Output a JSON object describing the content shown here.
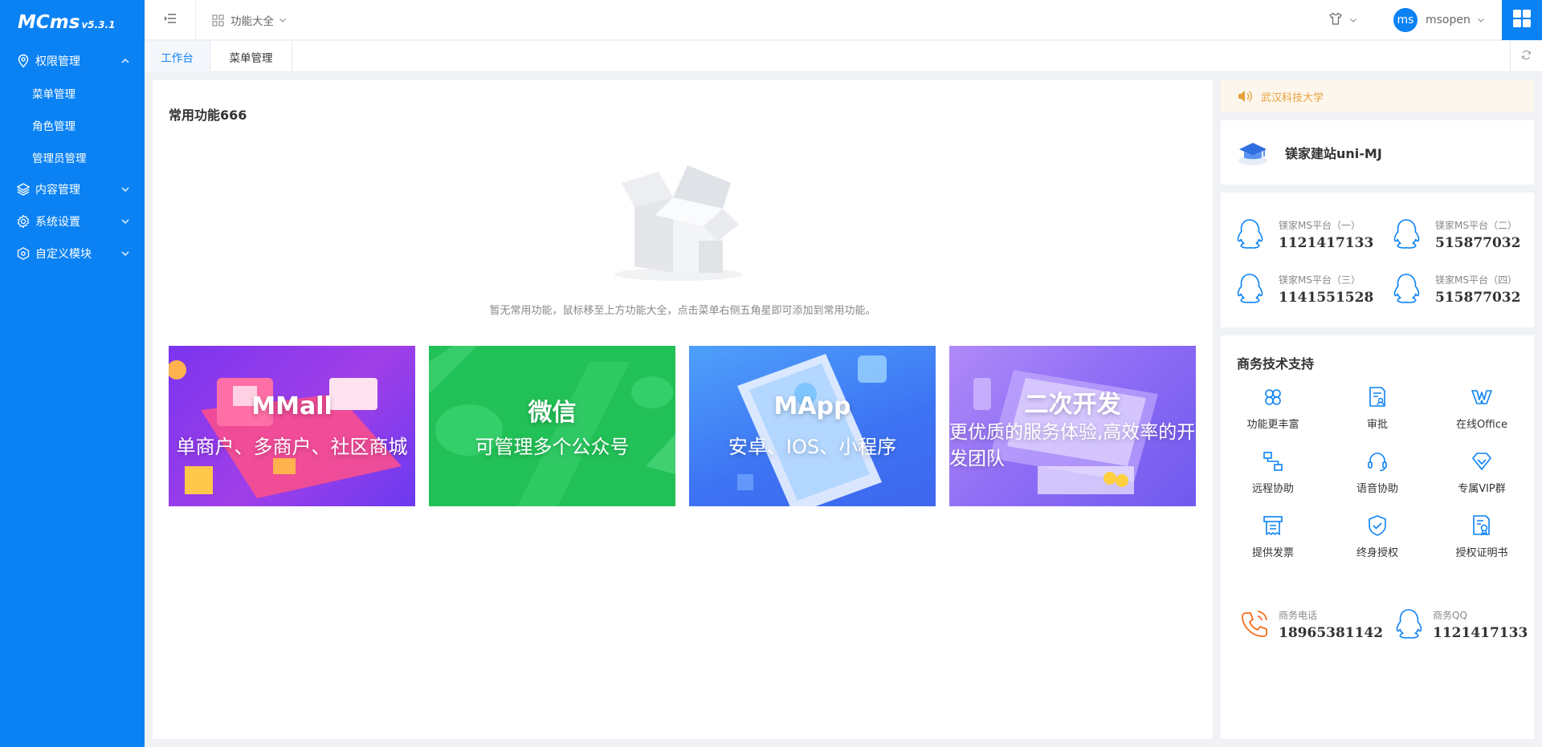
{
  "app": {
    "brand": "MCms",
    "version": "v5.3.1"
  },
  "sidebar": {
    "groups": [
      {
        "label": "权限管理",
        "expanded": true,
        "icon": "map-pin-icon",
        "items": [
          {
            "label": "菜单管理"
          },
          {
            "label": "角色管理"
          },
          {
            "label": "管理员管理"
          }
        ]
      },
      {
        "label": "内容管理",
        "expanded": false,
        "icon": "layers-icon"
      },
      {
        "label": "系统设置",
        "expanded": false,
        "icon": "gear-icon"
      },
      {
        "label": "自定义模块",
        "expanded": false,
        "icon": "module-icon"
      }
    ]
  },
  "header": {
    "func_all_label": "功能大全",
    "user": {
      "avatar_text": "ms",
      "name": "msopen"
    }
  },
  "tabs": [
    {
      "label": "工作台",
      "active": true
    },
    {
      "label": "菜单管理",
      "active": false
    }
  ],
  "main": {
    "title": "常用功能666",
    "empty_text": "暂无常用功能，鼠标移至上方功能大全，点击菜单右侧五角星即可添加到常用功能。",
    "banners": [
      {
        "title": "MMall",
        "subtitle": "单商户、多商户、社区商城",
        "color": "#8a3ff0"
      },
      {
        "title": "微信",
        "subtitle": "可管理多个公众号",
        "color": "#22c157"
      },
      {
        "title": "MApp",
        "subtitle": "安卓、IOS、小程序",
        "color": "#3f7ff5"
      },
      {
        "title": "二次开发",
        "subtitle": "更优质的服务体验,高效率的开发团队",
        "color": "#9b6cf6"
      }
    ]
  },
  "right": {
    "notice": "武汉科技大学",
    "product": {
      "name": "镁家建站uni-MJ"
    },
    "qq_groups": [
      {
        "label": "镁家MS平台（一）",
        "number": "1121417133"
      },
      {
        "label": "镁家MS平台（二）",
        "number": "515877032"
      },
      {
        "label": "镁家MS平台（三）",
        "number": "1141551528"
      },
      {
        "label": "镁家MS平台（四）",
        "number": "515877032"
      }
    ],
    "support": {
      "title": "商务技术支持",
      "items": [
        {
          "label": "功能更丰富",
          "icon": "clover-icon"
        },
        {
          "label": "审批",
          "icon": "approval-doc-icon"
        },
        {
          "label": "在线Office",
          "icon": "wps-office-icon"
        },
        {
          "label": "远程协助",
          "icon": "remote-flow-icon"
        },
        {
          "label": "语音协助",
          "icon": "headset-icon"
        },
        {
          "label": "专属VIP群",
          "icon": "diamond-icon"
        },
        {
          "label": "提供发票",
          "icon": "invoice-icon"
        },
        {
          "label": "终身授权",
          "icon": "shield-check-icon"
        },
        {
          "label": "授权证明书",
          "icon": "certificate-icon"
        }
      ],
      "phone": {
        "label": "商务电话",
        "number": "18965381142"
      },
      "qq": {
        "label": "商务QQ",
        "number": "1121417133"
      }
    }
  },
  "colors": {
    "primary": "#0b82f4",
    "notice_text": "#e6a23c",
    "notice_bg": "#fdf6ec",
    "phone_icon": "#f56c1c"
  }
}
